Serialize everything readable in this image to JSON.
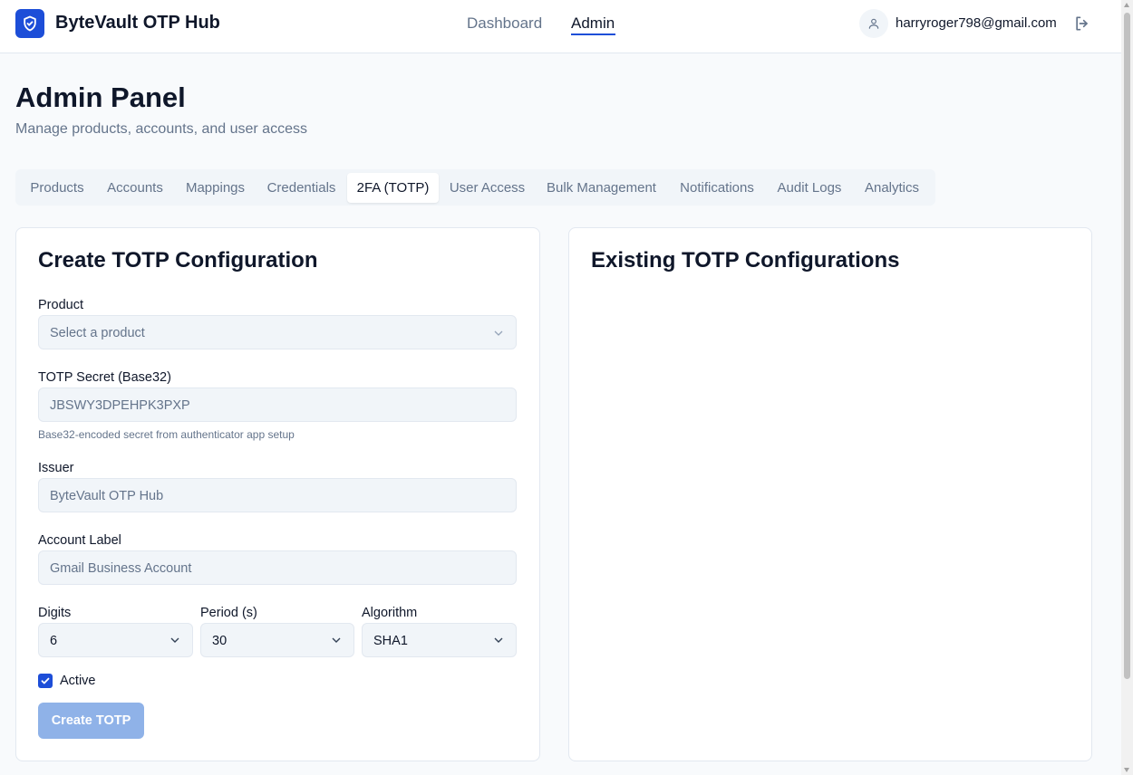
{
  "header": {
    "app_title": "ByteVault OTP Hub",
    "nav": [
      {
        "label": "Dashboard",
        "active": false
      },
      {
        "label": "Admin",
        "active": true
      }
    ],
    "user_email": "harryroger798@gmail.com",
    "icons": {
      "logo": "shield-check-icon",
      "avatar": "user-icon",
      "logout": "logout-icon"
    }
  },
  "page": {
    "title": "Admin Panel",
    "subtitle": "Manage products, accounts, and user access"
  },
  "tabs": [
    {
      "label": "Products",
      "active": false
    },
    {
      "label": "Accounts",
      "active": false
    },
    {
      "label": "Mappings",
      "active": false
    },
    {
      "label": "Credentials",
      "active": false
    },
    {
      "label": "2FA (TOTP)",
      "active": true
    },
    {
      "label": "User Access",
      "active": false
    },
    {
      "label": "Bulk Management",
      "active": false
    },
    {
      "label": "Notifications",
      "active": false
    },
    {
      "label": "Audit Logs",
      "active": false
    },
    {
      "label": "Analytics",
      "active": false
    }
  ],
  "create_form": {
    "title": "Create TOTP Configuration",
    "product": {
      "label": "Product",
      "placeholder": "Select a product"
    },
    "secret": {
      "label": "TOTP Secret (Base32)",
      "placeholder": "JBSWY3DPEHPK3PXP",
      "hint": "Base32-encoded secret from authenticator app setup"
    },
    "issuer": {
      "label": "Issuer",
      "placeholder": "ByteVault OTP Hub"
    },
    "account_label": {
      "label": "Account Label",
      "placeholder": "Gmail Business Account"
    },
    "digits": {
      "label": "Digits",
      "value": "6"
    },
    "period": {
      "label": "Period (s)",
      "value": "30"
    },
    "algorithm": {
      "label": "Algorithm",
      "value": "SHA1"
    },
    "active": {
      "label": "Active",
      "checked": true
    },
    "submit_label": "Create TOTP"
  },
  "existing": {
    "title": "Existing TOTP Configurations"
  },
  "colors": {
    "accent": "#1d4ed8",
    "button_disabled": "#8fb2e8",
    "muted_text": "#64748b",
    "input_bg": "#f1f5f9"
  }
}
